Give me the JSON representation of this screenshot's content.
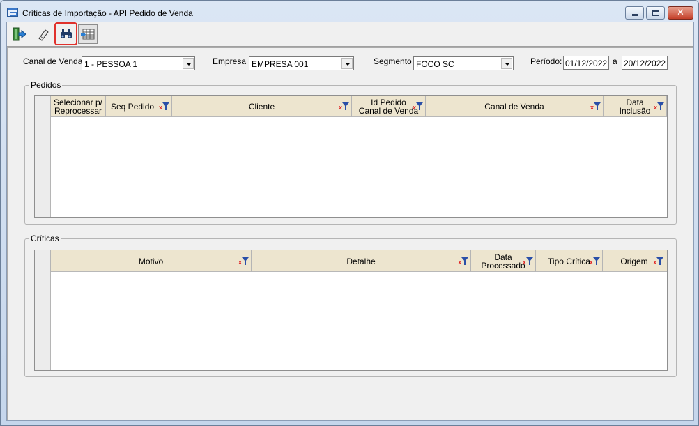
{
  "window": {
    "title": "Críticas de Importação - API Pedido de Venda",
    "close_glyph": "✕"
  },
  "toolbar": {
    "buttons": [
      {
        "name": "exit-icon"
      },
      {
        "name": "eraser-icon"
      },
      {
        "name": "binoculars-icon"
      },
      {
        "name": "grid-export-icon"
      }
    ]
  },
  "filters": {
    "canal_label": "Canal de Venda",
    "canal_value": "1 - PESSOA 1",
    "empresa_label": "Empresa",
    "empresa_value": "EMPRESA 001",
    "segmento_label": "Segmento",
    "segmento_value": "FOCO SC",
    "periodo_label": "Período:",
    "periodo_from": "01/12/2022",
    "periodo_sep": "a",
    "periodo_to": "20/12/2022"
  },
  "pedidos": {
    "title": "Pedidos",
    "columns": [
      "Selecionar p/\nReprocessar",
      "Seq Pedido",
      "Cliente",
      "Id Pedido\nCanal de Venda",
      "Canal de Venda",
      "Data\nInclusão"
    ]
  },
  "criticas": {
    "title": "Críticas",
    "columns": [
      "Motivo",
      "Detalhe",
      "Data\nProcessado",
      "Tipo Crítica",
      "Origem"
    ]
  },
  "colors": {
    "header_bg": "#ede5cf",
    "highlight": "#e0312c",
    "filter_icon_blue": "#2a4fa8",
    "filter_icon_red": "#e02020"
  }
}
